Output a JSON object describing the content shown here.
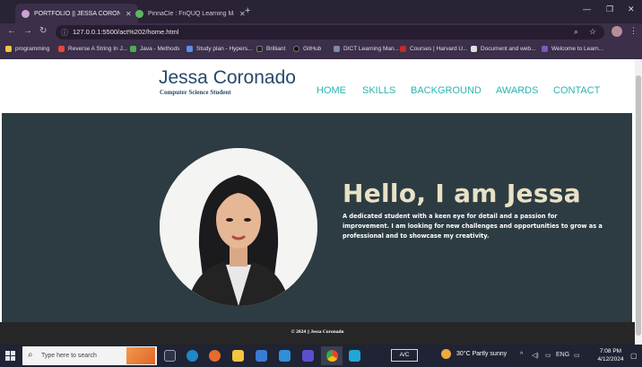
{
  "browser": {
    "tabs": [
      {
        "title": "PORTFOLIO || JESSA CORONADO",
        "color": "#c9a3d6"
      },
      {
        "title": "PinnaCle : FnQUQ Learning Ma...",
        "color": "#5cb85c"
      }
    ],
    "new_tab": "+",
    "window": {
      "minimize": "—",
      "restore": "❐",
      "close": "✕"
    },
    "nav": {
      "back": "←",
      "forward": "→",
      "reload": "↻"
    },
    "url": "127.0.0.1:5500/act%202/home.html",
    "bookmarks": [
      {
        "label": "programming",
        "color": "#f5c542"
      },
      {
        "label": "Reverse A String In J...",
        "color": "#e8473a"
      },
      {
        "label": "Java - Methods",
        "color": "#4caf50"
      },
      {
        "label": "Study plan - Hypers...",
        "color": "#5b8def"
      },
      {
        "label": "Brilliant",
        "color": "#222222"
      },
      {
        "label": "GitHub",
        "color": "#111111"
      },
      {
        "label": "DICT Learning Man...",
        "color": "#7c8aa8"
      },
      {
        "label": "Courses | Harvard U...",
        "color": "#c62828"
      },
      {
        "label": "Document and web...",
        "color": "#e0e0e0"
      },
      {
        "label": "Welcome to Learn...",
        "color": "#7e57c2"
      }
    ]
  },
  "site": {
    "name": "Jessa Coronado",
    "subtitle": "Computer Science Student",
    "nav": [
      "HOME",
      "SKILLS",
      "BACKGROUND",
      "AWARDS",
      "CONTACT"
    ],
    "hero": {
      "title": "Hello, I am Jessa",
      "text": "A dedicated student with a keen eye for detail and a passion for improvement. I am looking for new challenges and opportunities to grow as a professional and to showcase my creativity."
    },
    "footer": "© 2024 || Jessa Coronado",
    "colors": {
      "header_text": "#264a6a",
      "nav": "#2bb5b0",
      "hero_bg": "#2c3c42",
      "hero_title": "#e9e1c6",
      "footer_bg": "#272727"
    }
  },
  "taskbar": {
    "search_placeholder": "Type here to search",
    "ac_label": "A/C",
    "weather": "30°C  Partly sunny",
    "lang": "ENG",
    "time": "7:08 PM",
    "date": "4/12/2024"
  }
}
